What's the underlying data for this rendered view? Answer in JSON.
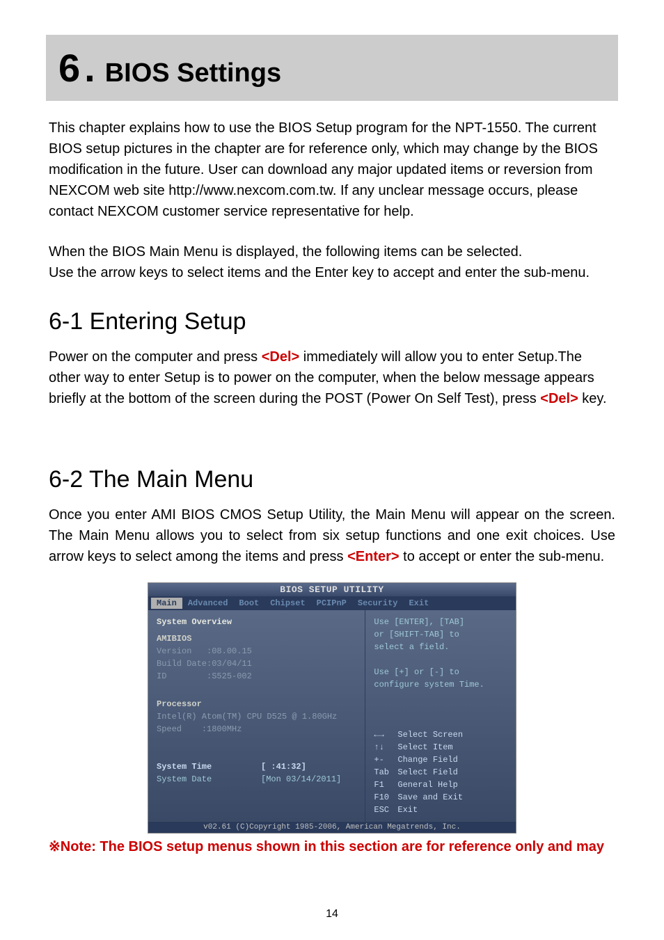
{
  "chapter": {
    "number": "6",
    "title": "BIOS Settings"
  },
  "intro_p1": "This chapter explains how to use the BIOS Setup program for the NPT-1550. The current BIOS setup pictures in the chapter are for reference only, which may change by the BIOS modification in the future. User can download any major updated items or reversion from NEXCOM web site http://www.nexcom.com.tw. If any unclear message occurs, please contact NEXCOM customer service representative for help.",
  "intro_p2_l1": "When the BIOS Main Menu is displayed, the following items can be selected.",
  "intro_p2_l2": "Use the arrow keys to select items and the Enter key to accept and enter the sub-menu.",
  "section61": {
    "heading": "6-1 Entering Setup",
    "text_pre": "Power on the computer and press ",
    "del1": "<Del>",
    "text_mid": " immediately will allow you to enter Setup.The other way to enter Setup is to power on the computer, when the below message appears briefly at the bottom of the screen during the POST (Power On Self Test), press ",
    "del2": "<Del>",
    "text_post": " key."
  },
  "section62": {
    "heading": "6-2 The Main Menu",
    "text_pre": "Once you enter AMI BIOS CMOS Setup Utility, the Main Menu will appear on the screen. The Main Menu allows you to select from six setup functions and one exit choices. Use arrow keys to select among the items and press ",
    "enter": "<Enter>",
    "text_post": " to accept or enter the sub-menu."
  },
  "bios": {
    "title": "BIOS SETUP UTILITY",
    "tabs": [
      "Main",
      "Advanced",
      "Boot",
      "Chipset",
      "PCIPnP",
      "Security",
      "Exit"
    ],
    "overview": "System Overview",
    "amibios": "AMIBIOS",
    "version_lbl": "Version",
    "version_val": ":08.00.15",
    "build_lbl": "Build Date",
    "build_val": ":03/04/11",
    "id_lbl": "ID",
    "id_val": ":S525-002",
    "processor": "Processor",
    "cpu": "Intel(R) Atom(TM) CPU D525   @ 1.80GHz",
    "speed_lbl": "Speed",
    "speed_val": ":1800MHz",
    "systime_lbl": "System Time",
    "systime_val": "[  :41:32]",
    "sysdate_lbl": "System Date",
    "sysdate_val": "[Mon 03/14/2011]",
    "help1": "Use [ENTER], [TAB]",
    "help2": "or [SHIFT-TAB] to",
    "help3": "select a field.",
    "help4": "Use [+] or [-] to",
    "help5": "configure system Time.",
    "nav": [
      {
        "k": "←→",
        "v": "Select Screen"
      },
      {
        "k": "↑↓",
        "v": "Select Item"
      },
      {
        "k": "+-",
        "v": "Change Field"
      },
      {
        "k": "Tab",
        "v": "Select Field"
      },
      {
        "k": "F1",
        "v": "General Help"
      },
      {
        "k": "F10",
        "v": "Save and Exit"
      },
      {
        "k": "ESC",
        "v": "Exit"
      }
    ],
    "footer": "v02.61 (C)Copyright 1985-2006, American Megatrends, Inc."
  },
  "note": {
    "star": "※",
    "text": "Note: The BIOS setup menus shown in this section are for reference only and may"
  },
  "page_number": "14"
}
